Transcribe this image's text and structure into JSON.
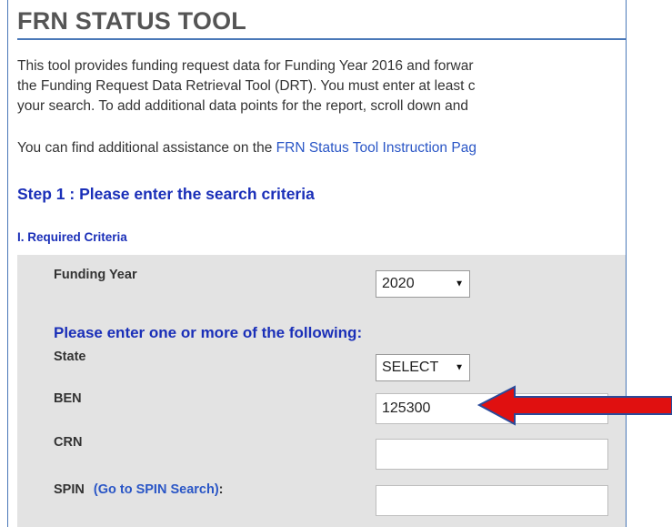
{
  "page": {
    "title": "FRN STATUS TOOL",
    "intro_line1": "This tool provides funding request data for Funding Year 2016 and forwar",
    "intro_line2": "the Funding Request Data Retrieval Tool (DRT). You must enter at least c",
    "intro_line3": "your search. To add additional data points for the report, scroll down and",
    "assist_prefix": "You can find additional assistance on the ",
    "assist_link": "FRN Status Tool Instruction Pag",
    "step1_title": "Step 1 : Please enter the search criteria",
    "section_required": "I. Required Criteria"
  },
  "form": {
    "funding_year_label": "Funding Year",
    "funding_year_value": "2020",
    "instruction": "Please enter one or more of the following:",
    "state_label": "State",
    "state_value": "SELECT",
    "ben_label": "BEN",
    "ben_value": "125300",
    "crn_label": "CRN",
    "crn_value": "",
    "spin_label": "SPIN",
    "spin_link": "(Go to SPIN Search)",
    "spin_colon": ":",
    "spin_value": ""
  },
  "annotation": {
    "arrow_color": "#e01010",
    "arrow_outline": "#2a4a9a"
  },
  "colors": {
    "accent_blue": "#1a2fb8",
    "link_blue": "#2a56c6",
    "panel_gray": "#e3e3e3",
    "frame_border": "#4a78b8"
  }
}
